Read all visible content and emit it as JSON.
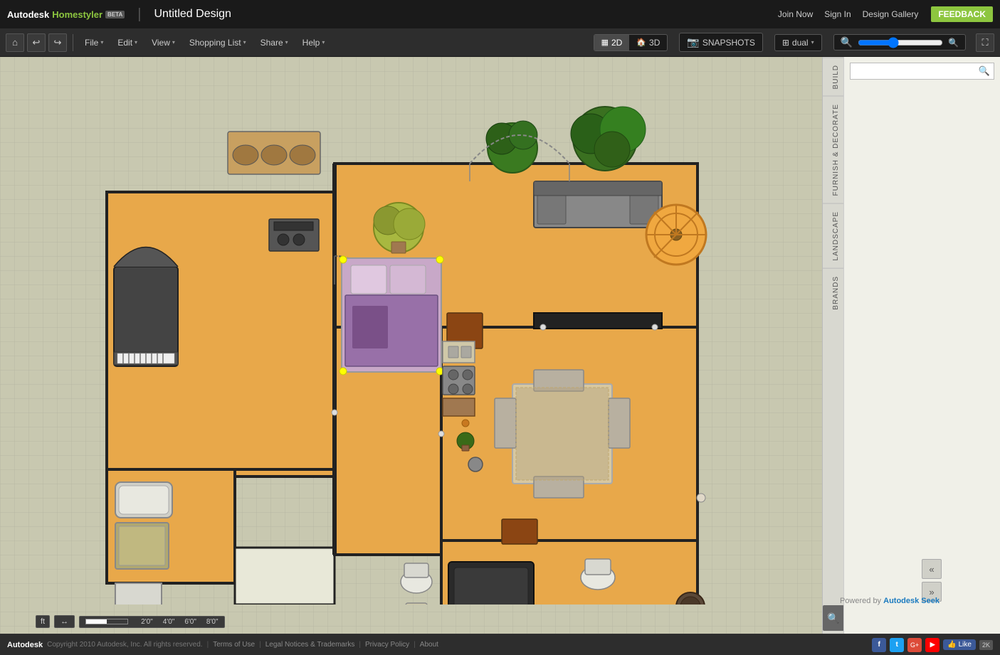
{
  "app": {
    "name": "Autodesk",
    "product": "Homestyler",
    "beta": "BETA",
    "project_title": "Untitled Design"
  },
  "top_bar": {
    "join_now": "Join Now",
    "sign_in": "Sign In",
    "design_gallery": "Design Gallery",
    "feedback": "FEEDBACK"
  },
  "toolbar": {
    "file": "File",
    "edit": "Edit",
    "view": "View",
    "shopping_list": "Shopping List",
    "share": "Share",
    "help": "Help",
    "view_2d": "2D",
    "view_3d": "3D",
    "snapshots": "SNAPSHOTS",
    "dual": "dual"
  },
  "sidebar": {
    "build_tab": "BUILD",
    "furnish_tab": "FURNISH & DECORATE",
    "landscape_tab": "LANDSCAPE",
    "brands_tab": "BRANDS",
    "search_placeholder": ""
  },
  "footer": {
    "copyright": "Copyright 2010 Autodesk, Inc. All rights reserved.",
    "terms": "Terms of Use",
    "legal": "Legal Notices & Trademarks",
    "privacy": "Privacy Policy",
    "about": "About",
    "powered_by": "Powered by",
    "powered_brand": "Autodesk Seek",
    "like": "Like",
    "count_2k": "2K"
  },
  "scale": {
    "units": "ft",
    "marks": [
      "2'0\"",
      "4'0\"",
      "6'0\"",
      "8'0\""
    ]
  }
}
